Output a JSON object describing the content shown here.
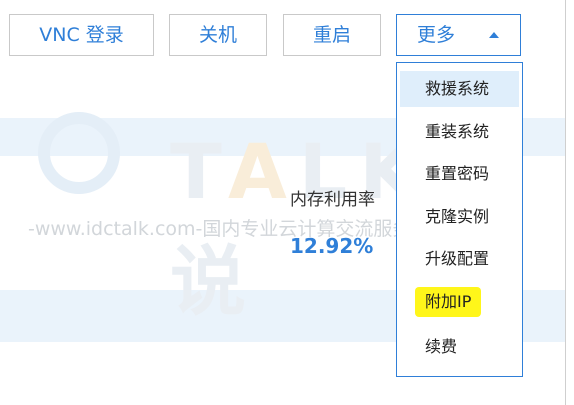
{
  "toolbar": {
    "vnc_label": "VNC 登录",
    "shutdown_label": "关机",
    "restart_label": "重启",
    "more_label": "更多"
  },
  "stats": {
    "memory_label": "内存利用率",
    "memory_value": "12.92%"
  },
  "watermark": {
    "brand": "TALK云说",
    "line": "-www.idctalk.com-国内专业云计算交流服务平台-"
  },
  "more_menu": {
    "items": [
      {
        "label": "救援系统"
      },
      {
        "label": "重装系统"
      },
      {
        "label": "重置密码"
      },
      {
        "label": "克隆实例"
      },
      {
        "label": "升级配置"
      },
      {
        "label": "附加IP",
        "highlighted": true
      },
      {
        "label": "续费"
      }
    ]
  },
  "colors": {
    "accent": "#2f7fd8",
    "band": "#eaf3fb",
    "highlight": "#fff61a"
  }
}
